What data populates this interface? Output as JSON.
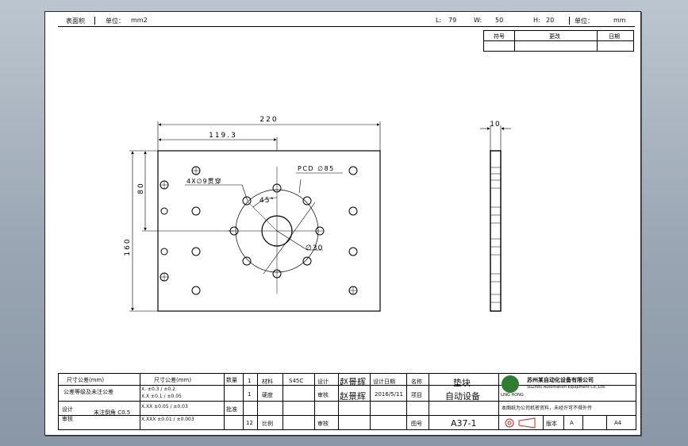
{
  "topbar": {
    "area_label": "表面积",
    "unit_label_1": "单位：",
    "unit_value_1": "mm2",
    "l_label": "L:",
    "l_value": "79",
    "w_label": "W:",
    "w_value": "50",
    "h_label": "H:",
    "h_value": "20",
    "unit_label_2": "单位：",
    "unit_value_2": "mm"
  },
  "revision_table": {
    "col_1": "符号",
    "col_2": "更改",
    "col_3": "日期"
  },
  "dimensions": {
    "width_overall": "220",
    "center_x": "119.3",
    "center_y": "80",
    "height_overall": "160",
    "pcd": "PCD ∅85",
    "holes": "4X∅9贯穿",
    "angle": "45°",
    "bore": "∅30",
    "thickness": "10"
  },
  "title_block": {
    "tolerance_header_1": "尺寸公差(mm)",
    "tolerance_header_2": "尺寸公差(mm)",
    "tolerance_row_label": "公差等级及未注公差",
    "tol_rows": [
      "X.    ±0.3 / ±0.2",
      "X.X   ±0.1 / ±0.05",
      "X.XX  ±0.05 / ±0.03",
      "X.XXX ±0.01 / ±0.003"
    ],
    "general_label": "未注倒角 C0.5",
    "design_label": "设计",
    "check_label": "审核",
    "approve_label": "批准",
    "qty_label": "数量",
    "qty_1": "1",
    "qty_2": "1",
    "qty_3": "12",
    "material_label": "材料",
    "material_value": "S45C",
    "hardness_label": "硬度",
    "scale_label": "比例",
    "drafter_label": "设计",
    "drafter_name": "赵景辉",
    "checker_label": "审核",
    "checker_name": "赵景辉",
    "reviewer_label": "审核",
    "design_date_label": "设计日期",
    "design_date": "2016/5/11",
    "name_label": "名称",
    "name_value": "垫块",
    "project_label": "项目",
    "project_value": "自动设备",
    "part_no_label": "图号",
    "part_no_value": "A37-1",
    "company_name": "苏州某自动化设备有限公司",
    "company_en": "SuZhou Automation Equipment Co.,Ltd.",
    "company_note": "本图纸为公司机密资料，未经许可不得外传",
    "projection_label": "版本",
    "version_value": "A",
    "sheet_size": "A4",
    "logo_text": "LING HONG"
  }
}
